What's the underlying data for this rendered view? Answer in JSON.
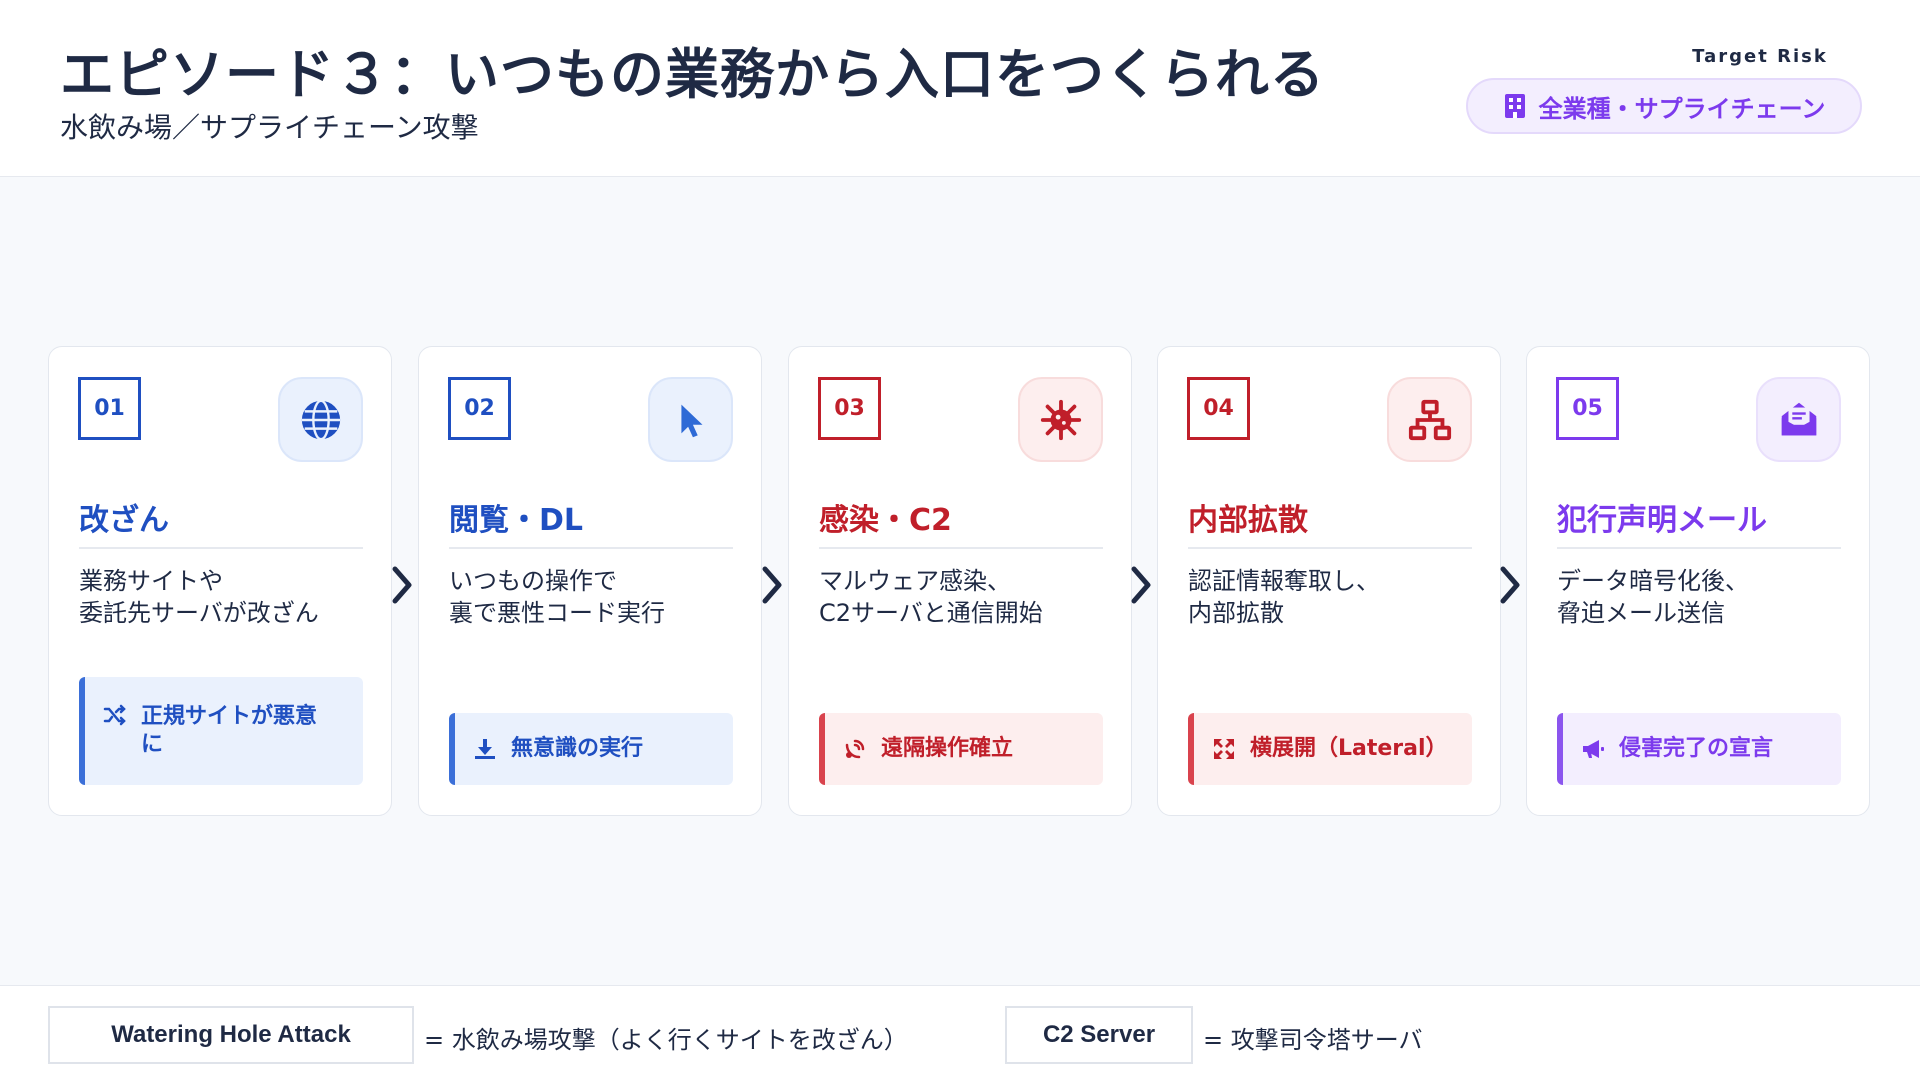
{
  "header": {
    "title": "エピソード３：いつもの業務から入口をつくられる",
    "subtitle": "水飲み場／サプライチェーン攻撃",
    "target_label": "Target Risk",
    "target_value": "全業種・サプライチェーン",
    "target_icon": "building-icon"
  },
  "steps": [
    {
      "num": "01",
      "title": "改ざん",
      "desc": "業務サイトや\n委託先サーバが改ざん",
      "badge": "正規サイトが悪意\nに",
      "icon": "globe-icon",
      "badge_icon": "shuffle-icon",
      "color": "#1f4fc1"
    },
    {
      "num": "02",
      "title": "閲覧・DL",
      "desc": "いつもの操作で\n裏で悪性コード実行",
      "badge": "無意識の実行",
      "icon": "cursor-icon",
      "badge_icon": "download-icon",
      "color": "#1f4fc1"
    },
    {
      "num": "03",
      "title": "感染・C2",
      "desc": "マルウェア感染、\nC2サーバと通信開始",
      "badge": "遠隔操作確立",
      "icon": "virus-icon",
      "badge_icon": "satellite-dish-icon",
      "color": "#c01f2a"
    },
    {
      "num": "04",
      "title": "内部拡散",
      "desc": "認証情報奪取し、\n内部拡散",
      "badge": "横展開（Lateral）",
      "icon": "network-icon",
      "badge_icon": "expand-arrows-icon",
      "color": "#c01f2a"
    },
    {
      "num": "05",
      "title": "犯行声明メール",
      "desc": "データ暗号化後、\n脅迫メール送信",
      "badge": "侵害完了の宣言",
      "icon": "envelope-open-icon",
      "badge_icon": "megaphone-icon",
      "color": "#7c3aed"
    }
  ],
  "glossary": [
    {
      "term": "Watering Hole Attack",
      "definition": "= 水飲み場攻撃（よく行くサイトを改ざん）"
    },
    {
      "term": "C2 Server",
      "definition": "= 攻撃司令塔サーバ"
    }
  ]
}
